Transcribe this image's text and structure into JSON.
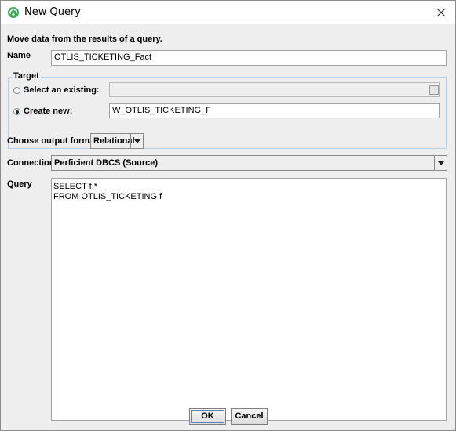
{
  "window": {
    "title": "New Query"
  },
  "intro": "Move data from the results of a query.",
  "name": {
    "label": "Name",
    "value": "OTLIS_TICKETING_Fact"
  },
  "target": {
    "title": "Target",
    "existing_label": "Select an existing:",
    "existing_value": "",
    "create_label": "Create new:",
    "create_value": "W_OTLIS_TICKETING_F",
    "selected": "create"
  },
  "output_format": {
    "label": "Choose output format:",
    "value": "Relational"
  },
  "connection": {
    "label": "Connection:",
    "value": "Perficient DBCS (Source)"
  },
  "query": {
    "label": "Query",
    "line1": "SELECT f.*",
    "line2": "FROM OTLIS_TICKETING f"
  },
  "buttons": {
    "ok": "OK",
    "cancel": "Cancel"
  },
  "colors": {
    "app_icon": "#3fa95c",
    "group_border": "#b8cfe5"
  }
}
